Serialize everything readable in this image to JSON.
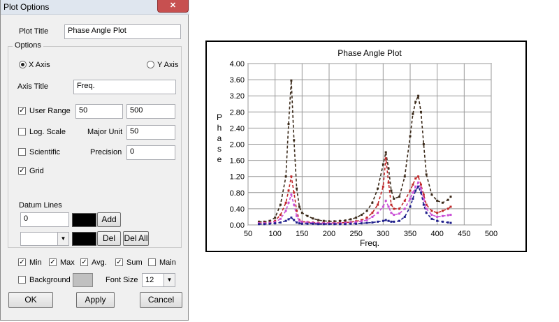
{
  "dialog": {
    "title": "Plot Options",
    "close_label": "✕",
    "plot_title_label": "Plot Title",
    "plot_title_value": "Phase Angle Plot",
    "options_label": "Options",
    "x_axis_label": "X Axis",
    "y_axis_label": "Y Axis",
    "selected_axis": "X Axis",
    "axis_title_label": "Axis Title",
    "axis_title_value": "Freq.",
    "user_range_label": "User Range",
    "user_range_checked": true,
    "range_min": "50",
    "range_max": "500",
    "log_scale_label": "Log. Scale",
    "log_scale_checked": false,
    "major_unit_label": "Major Unit",
    "major_unit_value": "50",
    "scientific_label": "Scientific",
    "scientific_checked": false,
    "precision_label": "Precision",
    "precision_value": "0",
    "grid_label": "Grid",
    "grid_checked": true,
    "datum_lines_label": "Datum Lines",
    "datum_value": "0",
    "add_label": "Add",
    "del_label": "Del",
    "del_all_label": "Del All",
    "min_label": "Min",
    "max_label": "Max",
    "avg_label": "Avg.",
    "sum_label": "Sum",
    "main_label": "Main",
    "min_checked": true,
    "max_checked": true,
    "avg_checked": true,
    "sum_checked": true,
    "main_checked": false,
    "background_label": "Background",
    "background_checked": false,
    "font_size_label": "Font Size",
    "font_size_value": "12",
    "ok_label": "OK",
    "apply_label": "Apply",
    "cancel_label": "Cancel",
    "check_mark": "✓",
    "dropdown_arrow": "▼"
  },
  "chart_data": {
    "type": "line",
    "title": "Phase Angle Plot",
    "xlabel": "Freq.",
    "ylabel": "Phase",
    "xlim": [
      50,
      500
    ],
    "ylim": [
      0,
      4
    ],
    "x_ticks": [
      "50",
      "100",
      "150",
      "200",
      "250",
      "300",
      "350",
      "400",
      "450",
      "500"
    ],
    "y_ticks": [
      "0.00",
      "0.40",
      "0.80",
      "1.20",
      "1.60",
      "2.00",
      "2.40",
      "2.80",
      "3.20",
      "3.60",
      "4.00"
    ],
    "grid": true,
    "x": [
      70,
      80,
      90,
      100,
      110,
      120,
      125,
      130,
      135,
      140,
      145,
      150,
      160,
      170,
      180,
      190,
      200,
      210,
      220,
      230,
      240,
      250,
      260,
      270,
      280,
      290,
      300,
      305,
      310,
      315,
      320,
      330,
      340,
      350,
      355,
      360,
      365,
      370,
      375,
      380,
      390,
      400,
      410,
      420,
      425
    ],
    "series": [
      {
        "color": "#3b2a1a",
        "values": [
          0.08,
          0.08,
          0.1,
          0.18,
          0.5,
          1.2,
          2.5,
          3.58,
          2.1,
          0.9,
          0.45,
          0.3,
          0.22,
          0.16,
          0.12,
          0.1,
          0.09,
          0.09,
          0.1,
          0.11,
          0.14,
          0.18,
          0.25,
          0.35,
          0.55,
          0.9,
          1.5,
          1.8,
          1.4,
          0.85,
          0.65,
          0.7,
          1.2,
          2.2,
          2.75,
          3.05,
          3.2,
          2.8,
          2.0,
          1.25,
          0.75,
          0.6,
          0.55,
          0.62,
          0.7
        ]
      },
      {
        "color": "#c0282a",
        "values": [
          0.05,
          0.05,
          0.06,
          0.1,
          0.25,
          0.55,
          0.85,
          1.2,
          0.8,
          0.35,
          0.12,
          0.08,
          0.07,
          0.06,
          0.05,
          0.05,
          0.05,
          0.05,
          0.05,
          0.06,
          0.07,
          0.09,
          0.12,
          0.18,
          0.3,
          0.5,
          0.95,
          1.65,
          1.05,
          0.5,
          0.4,
          0.4,
          0.6,
          0.85,
          1.0,
          1.15,
          1.2,
          1.0,
          0.75,
          0.5,
          0.35,
          0.3,
          0.35,
          0.4,
          0.45
        ]
      },
      {
        "color": "#c94fd6",
        "values": [
          0.04,
          0.04,
          0.05,
          0.07,
          0.15,
          0.35,
          0.55,
          0.75,
          0.5,
          0.22,
          0.1,
          0.07,
          0.06,
          0.05,
          0.04,
          0.04,
          0.04,
          0.04,
          0.04,
          0.05,
          0.06,
          0.07,
          0.09,
          0.12,
          0.2,
          0.3,
          0.45,
          0.6,
          0.45,
          0.3,
          0.25,
          0.28,
          0.4,
          0.65,
          0.8,
          0.95,
          1.05,
          0.9,
          0.65,
          0.4,
          0.25,
          0.2,
          0.22,
          0.24,
          0.25
        ]
      },
      {
        "color": "#1f1f8c",
        "values": [
          0.02,
          0.02,
          0.03,
          0.04,
          0.06,
          0.1,
          0.14,
          0.18,
          0.12,
          0.06,
          0.04,
          0.03,
          0.03,
          0.03,
          0.02,
          0.02,
          0.02,
          0.02,
          0.02,
          0.02,
          0.03,
          0.03,
          0.04,
          0.05,
          0.06,
          0.08,
          0.1,
          0.12,
          0.1,
          0.08,
          0.08,
          0.1,
          0.2,
          0.45,
          0.65,
          0.85,
          0.95,
          0.8,
          0.5,
          0.3,
          0.15,
          0.1,
          0.08,
          0.06,
          0.05
        ]
      }
    ]
  }
}
